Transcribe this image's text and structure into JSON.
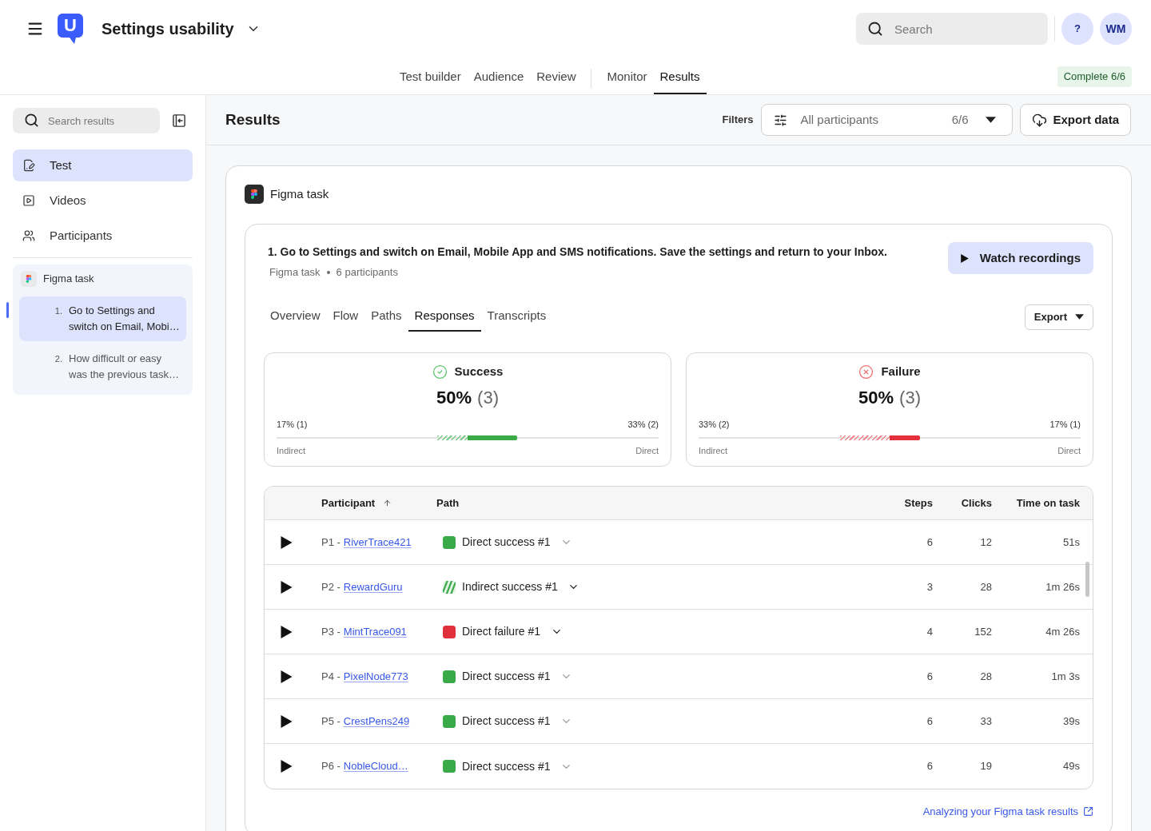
{
  "header": {
    "logo": "U",
    "title": "Settings usability",
    "search": {
      "placeholder": "Search"
    },
    "help": "?",
    "avatar": "WM"
  },
  "nav": [
    {
      "tabs": [
        {
          "label": "Test builder",
          "selected": false
        },
        {
          "label": "Audience",
          "selected": false
        },
        {
          "label": "Review",
          "selected": false
        }
      ]
    },
    {
      "tabs": [
        {
          "label": "Monitor",
          "selected": false
        },
        {
          "label": "Results",
          "selected": true
        }
      ]
    }
  ],
  "status_badge": "Complete 6/6",
  "sidebar": {
    "search": {
      "placeholder": "Search results"
    },
    "items": [
      {
        "kind": "test",
        "label": "Test",
        "selected": true
      },
      {
        "kind": "videos",
        "label": "Videos",
        "selected": false
      },
      {
        "kind": "participants",
        "label": "Participants",
        "selected": false
      }
    ],
    "task": {
      "label": "Figma task",
      "children": [
        {
          "number": "1.",
          "label": "Go to Settings and switch on Email, Mobi…",
          "selected": true
        },
        {
          "number": "2.",
          "label": "How difficult or easy was the previous task…",
          "selected": false
        }
      ]
    }
  },
  "results": {
    "title": "Results",
    "filters": {
      "label": "Filters",
      "value": "All participants",
      "count": "6/6"
    },
    "export_button": "Export data",
    "task_card": {
      "title": "Figma task",
      "question": {
        "text": "1. Go to Settings and switch on Email, Mobile App and SMS notifications. Save the settings and return to your Inbox.",
        "meta": [
          "Figma task",
          "6 participants"
        ],
        "watch_button": "Watch recordings"
      },
      "tabs": [
        {
          "label": "Overview",
          "selected": false
        },
        {
          "label": "Flow",
          "selected": false
        },
        {
          "label": "Paths",
          "selected": false
        },
        {
          "label": "Responses",
          "selected": true
        },
        {
          "label": "Transcripts",
          "selected": false
        }
      ],
      "export_button": "Export",
      "outcomes": [
        {
          "kind": "success",
          "label": "Success",
          "percent": "50%",
          "count": "(3)",
          "indirect": {
            "reading": "17% (1)",
            "label": "Indirect",
            "level": 0.16
          },
          "direct": {
            "reading": "33% (2)",
            "label": "Direct",
            "level": 0.26
          }
        },
        {
          "kind": "failure",
          "label": "Failure",
          "percent": "50%",
          "count": "(3)",
          "indirect": {
            "reading": "33% (2)",
            "label": "Indirect",
            "level": 0.26
          },
          "direct": {
            "reading": "17% (1)",
            "label": "Direct",
            "level": 0.16
          }
        }
      ],
      "table": {
        "columns": [
          {
            "label": "Participant",
            "sorted": true
          },
          {
            "label": "Path",
            "sorted": false
          },
          {
            "label": "Steps",
            "sorted": false
          },
          {
            "label": "Clicks",
            "sorted": false
          },
          {
            "label": "Time on task",
            "sorted": false
          }
        ],
        "rows": [
          {
            "participant_id": "P1 -",
            "participant_name": "RiverTrace421",
            "path": {
              "kind": "direct_success",
              "label": "Direct success #1"
            },
            "steps": "6",
            "clicks": "12",
            "time": "51s"
          },
          {
            "participant_id": "P2 -",
            "participant_name": "RewardGuru",
            "path": {
              "kind": "indirect_success",
              "label": "Indirect success #1"
            },
            "steps": "3",
            "clicks": "28",
            "time": "1m 26s"
          },
          {
            "participant_id": "P3 -",
            "participant_name": "MintTrace091",
            "path": {
              "kind": "direct_failure",
              "label": "Direct failure #1"
            },
            "steps": "4",
            "clicks": "152",
            "time": "4m 26s"
          },
          {
            "participant_id": "P4 -",
            "participant_name": "PixelNode773",
            "path": {
              "kind": "direct_success",
              "label": "Direct success #1"
            },
            "steps": "6",
            "clicks": "28",
            "time": "1m 3s"
          },
          {
            "participant_id": "P5 -",
            "participant_name": "CrestPens249",
            "path": {
              "kind": "direct_success",
              "label": "Direct success #1"
            },
            "steps": "6",
            "clicks": "33",
            "time": "39s"
          },
          {
            "participant_id": "P6 -",
            "participant_name": "NobleCloud…",
            "path": {
              "kind": "direct_success",
              "label": "Direct success #1"
            },
            "steps": "6",
            "clicks": "19",
            "time": "49s"
          }
        ]
      },
      "help_link": "Analyzing your Figma task results"
    }
  }
}
